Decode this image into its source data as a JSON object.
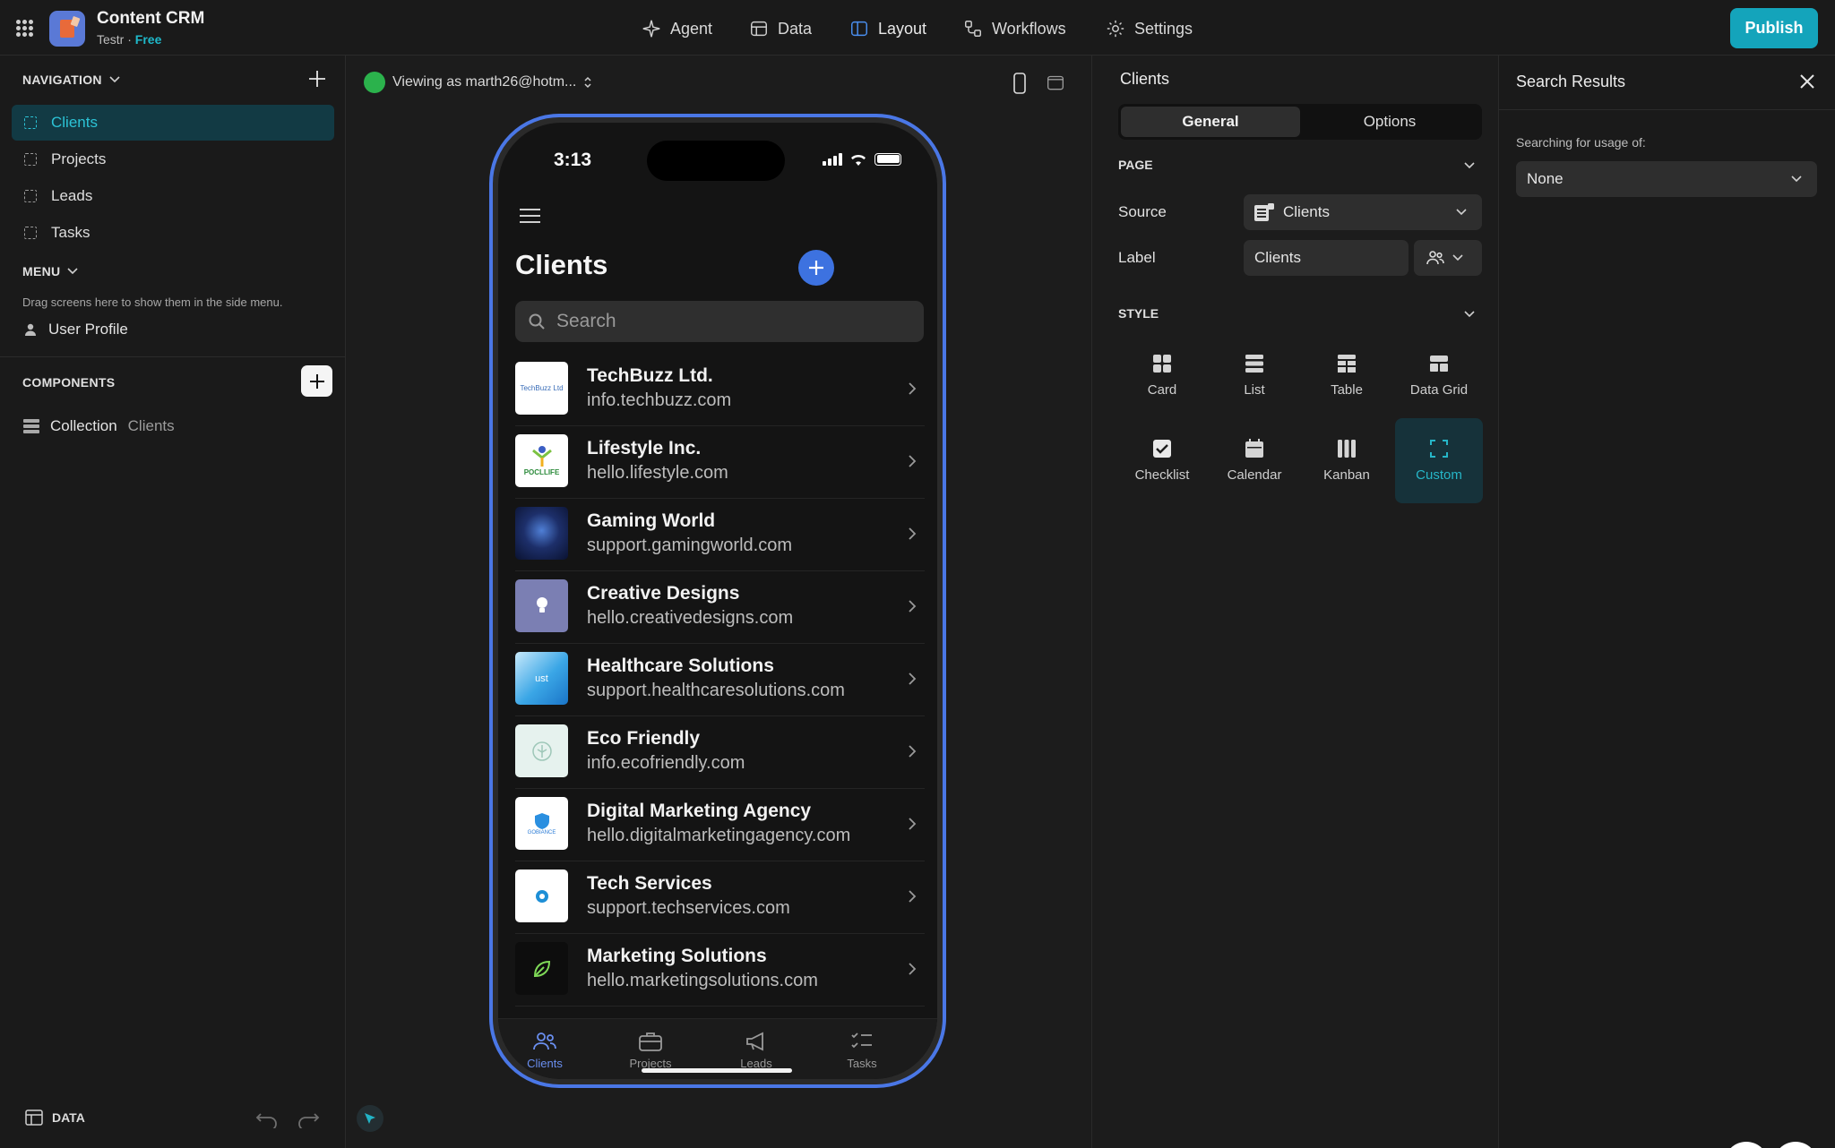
{
  "app": {
    "title": "Content CRM",
    "workspace": "Testr",
    "separator": " · ",
    "plan": "Free"
  },
  "topnav": [
    {
      "label": "Agent",
      "icon": "sparkle-icon"
    },
    {
      "label": "Data",
      "icon": "table-icon"
    },
    {
      "label": "Layout",
      "icon": "layout-icon",
      "active": true
    },
    {
      "label": "Workflows",
      "icon": "workflow-icon"
    },
    {
      "label": "Settings",
      "icon": "gear-icon"
    }
  ],
  "publish_label": "Publish",
  "sidebar": {
    "navigation_heading": "NAVIGATION",
    "nav_items": [
      {
        "label": "Clients",
        "active": true
      },
      {
        "label": "Projects"
      },
      {
        "label": "Leads"
      },
      {
        "label": "Tasks"
      }
    ],
    "menu_heading": "MENU",
    "menu_hint": "Drag screens here to show them in the side menu.",
    "menu_item": "User Profile",
    "components_heading": "COMPONENTS",
    "component": {
      "label": "Collection",
      "source": "Clients"
    },
    "data_label": "DATA"
  },
  "canvas": {
    "viewing_as": "Viewing as marth26@hotm..."
  },
  "phone": {
    "time": "3:13",
    "title": "Clients",
    "search_placeholder": "Search",
    "clients": [
      {
        "name": "TechBuzz Ltd.",
        "site": "info.techbuzz.com",
        "logo_text": "TechBuzz Ltd"
      },
      {
        "name": "Lifestyle Inc.",
        "site": "hello.lifestyle.com",
        "logo_text": "POCLLIFE"
      },
      {
        "name": "Gaming World",
        "site": "support.gamingworld.com",
        "logo_text": ""
      },
      {
        "name": "Creative Designs",
        "site": "hello.creativedesigns.com",
        "logo_text": ""
      },
      {
        "name": "Healthcare Solutions",
        "site": "support.healthcaresolutions.com",
        "logo_text": "ust"
      },
      {
        "name": "Eco Friendly",
        "site": "info.ecofriendly.com",
        "logo_text": ""
      },
      {
        "name": "Digital Marketing Agency",
        "site": "hello.digitalmarketingagency.com",
        "logo_text": "GOBIANCE"
      },
      {
        "name": "Tech Services",
        "site": "support.techservices.com",
        "logo_text": ""
      },
      {
        "name": "Marketing Solutions",
        "site": "hello.marketingsolutions.com",
        "logo_text": ""
      }
    ],
    "tabs": [
      "Clients",
      "Projects",
      "Leads",
      "Tasks"
    ]
  },
  "props": {
    "title": "Clients",
    "segments": [
      "General",
      "Options"
    ],
    "page_heading": "PAGE",
    "source_label": "Source",
    "source_value": "Clients",
    "label_label": "Label",
    "label_value": "Clients",
    "style_heading": "STYLE",
    "styles": [
      "Card",
      "List",
      "Table",
      "Data Grid",
      "Checklist",
      "Calendar",
      "Kanban",
      "Custom"
    ],
    "selected_style": "Custom"
  },
  "search_panel": {
    "title": "Search Results",
    "label": "Searching for usage of:",
    "value": "None"
  },
  "colors": {
    "accent": "#14a4bb",
    "phone_frame": "#4a77e6",
    "active_nav": "#2cc3d6"
  }
}
